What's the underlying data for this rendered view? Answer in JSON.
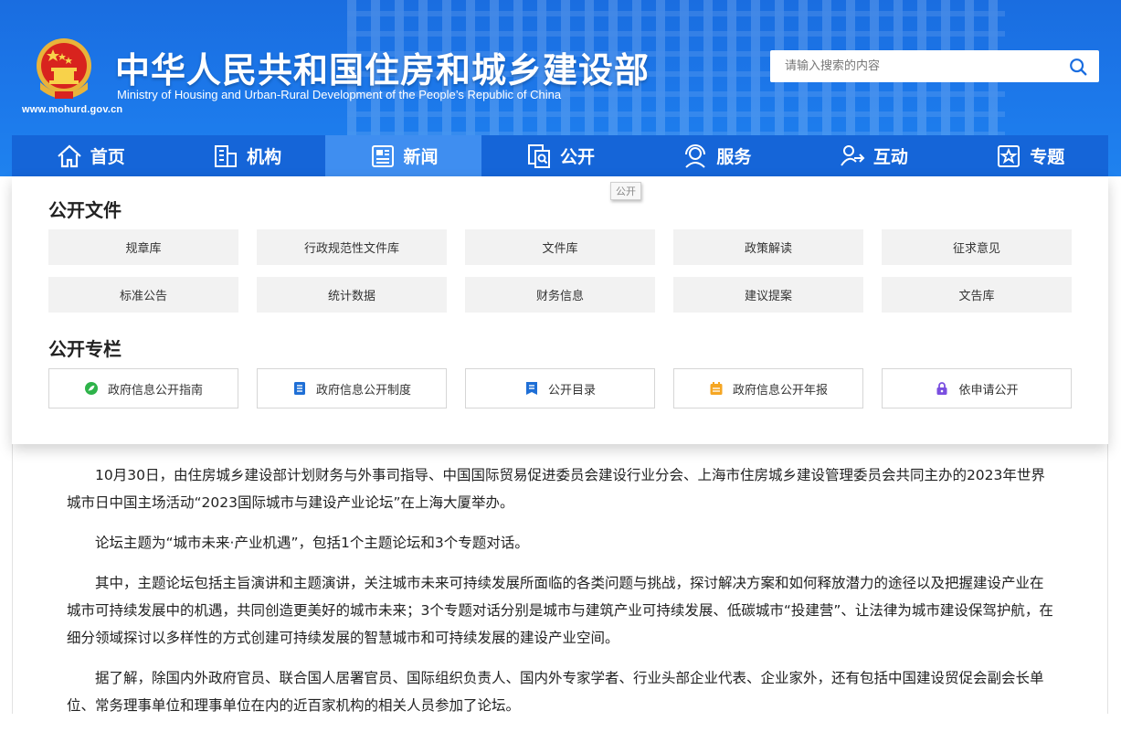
{
  "header": {
    "title_cn": "中华人民共和国住房和城乡建设部",
    "title_en": "Ministry of Housing and Urban-Rural Development of the People’s Republic of China",
    "site_url": "www.mohurd.gov.cn",
    "emblem_icon": "national-emblem-icon"
  },
  "search": {
    "placeholder": "请输入搜索的内容",
    "icon": "search-icon"
  },
  "nav": {
    "items": [
      {
        "label": "首页",
        "icon": "home-icon"
      },
      {
        "label": "机构",
        "icon": "building-icon"
      },
      {
        "label": "新闻",
        "icon": "news-icon",
        "active": true
      },
      {
        "label": "公开",
        "icon": "documents-icon"
      },
      {
        "label": "服务",
        "icon": "service-icon"
      },
      {
        "label": "互动",
        "icon": "interaction-icon"
      },
      {
        "label": "专题",
        "icon": "star-topic-icon"
      }
    ]
  },
  "tooltip": "公开",
  "dropdown": {
    "files_title": "公开文件",
    "files": [
      "规章库",
      "行政规范性文件库",
      "文件库",
      "政策解读",
      "征求意见",
      "标准公告",
      "统计数据",
      "财务信息",
      "建议提案",
      "文告库"
    ],
    "columns_title": "公开专栏",
    "columns": [
      {
        "label": "政府信息公开指南",
        "icon": "guide-icon",
        "color": "#2eb34a"
      },
      {
        "label": "政府信息公开制度",
        "icon": "document-icon",
        "color": "#1f6fd6"
      },
      {
        "label": "公开目录",
        "icon": "catalog-icon",
        "color": "#1f6fd6"
      },
      {
        "label": "政府信息公开年报",
        "icon": "calendar-icon",
        "color": "#f5a623"
      },
      {
        "label": "依申请公开",
        "icon": "lock-icon",
        "color": "#7a4fe0"
      }
    ]
  },
  "article": {
    "paragraphs": [
      "10月30日，由住房城乡建设部计划财务与外事司指导、中国国际贸易促进委员会建设行业分会、上海市住房城乡建设管理委员会共同主办的2023年世界城市日中国主场活动“2023国际城市与建设产业论坛”在上海大厦举办。",
      "论坛主题为“城市未来·产业机遇”，包括1个主题论坛和3个专题对话。",
      "其中，主题论坛包括主旨演讲和主题演讲，关注城市未来可持续发展所面临的各类问题与挑战，探讨解决方案和如何释放潜力的途径以及把握建设产业在城市可持续发展中的机遇，共同创造更美好的城市未来；3个专题对话分别是城市与建筑产业可持续发展、低碳城市“投建营”、让法律为城市建设保驾护航，在细分领域探讨以多样性的方式创建可持续发展的智慧城市和可持续发展的建设产业空间。",
      "据了解，除国内外政府官员、联合国人居署官员、国际组织负责人、国内外专家学者、行业头部企业代表、企业家外，还有包括中国建设贸促会副会长单位、常务理事单位和理事单位在内的近百家机构的相关人员参加了论坛。"
    ]
  },
  "colors": {
    "header_blue": "#1c78ea",
    "nav_blue": "#1565d8",
    "nav_active": "#3f8ef0"
  }
}
